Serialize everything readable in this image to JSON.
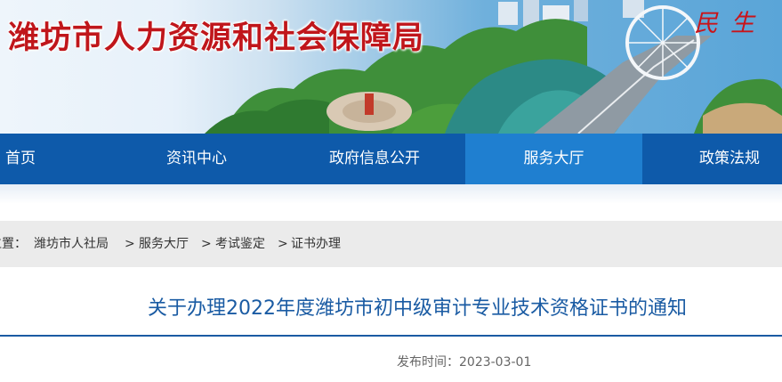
{
  "site": {
    "title": "潍坊市人力资源和社会保障局",
    "slogan": "民生"
  },
  "nav": {
    "items": [
      {
        "label": "首页",
        "active": false
      },
      {
        "label": "资讯中心",
        "active": false
      },
      {
        "label": "政府信息公开",
        "active": false
      },
      {
        "label": "服务大厅",
        "active": true
      },
      {
        "label": "政策法规",
        "active": false
      }
    ]
  },
  "breadcrumb": {
    "prefix": "位置：",
    "items": [
      "潍坊市人社局",
      "服务大厅",
      "考试鉴定",
      "证书办理"
    ],
    "separator": ">"
  },
  "article": {
    "title": "关于办理2022年度潍坊市初中级审计专业技术资格证书的通知",
    "publish_label": "发布时间：",
    "publish_date": "2023-03-01"
  },
  "colors": {
    "nav_bg": "#0e5aaa",
    "nav_active": "#1f7fd0",
    "title_red": "#c0161b",
    "article_blue": "#1a5ba3"
  }
}
